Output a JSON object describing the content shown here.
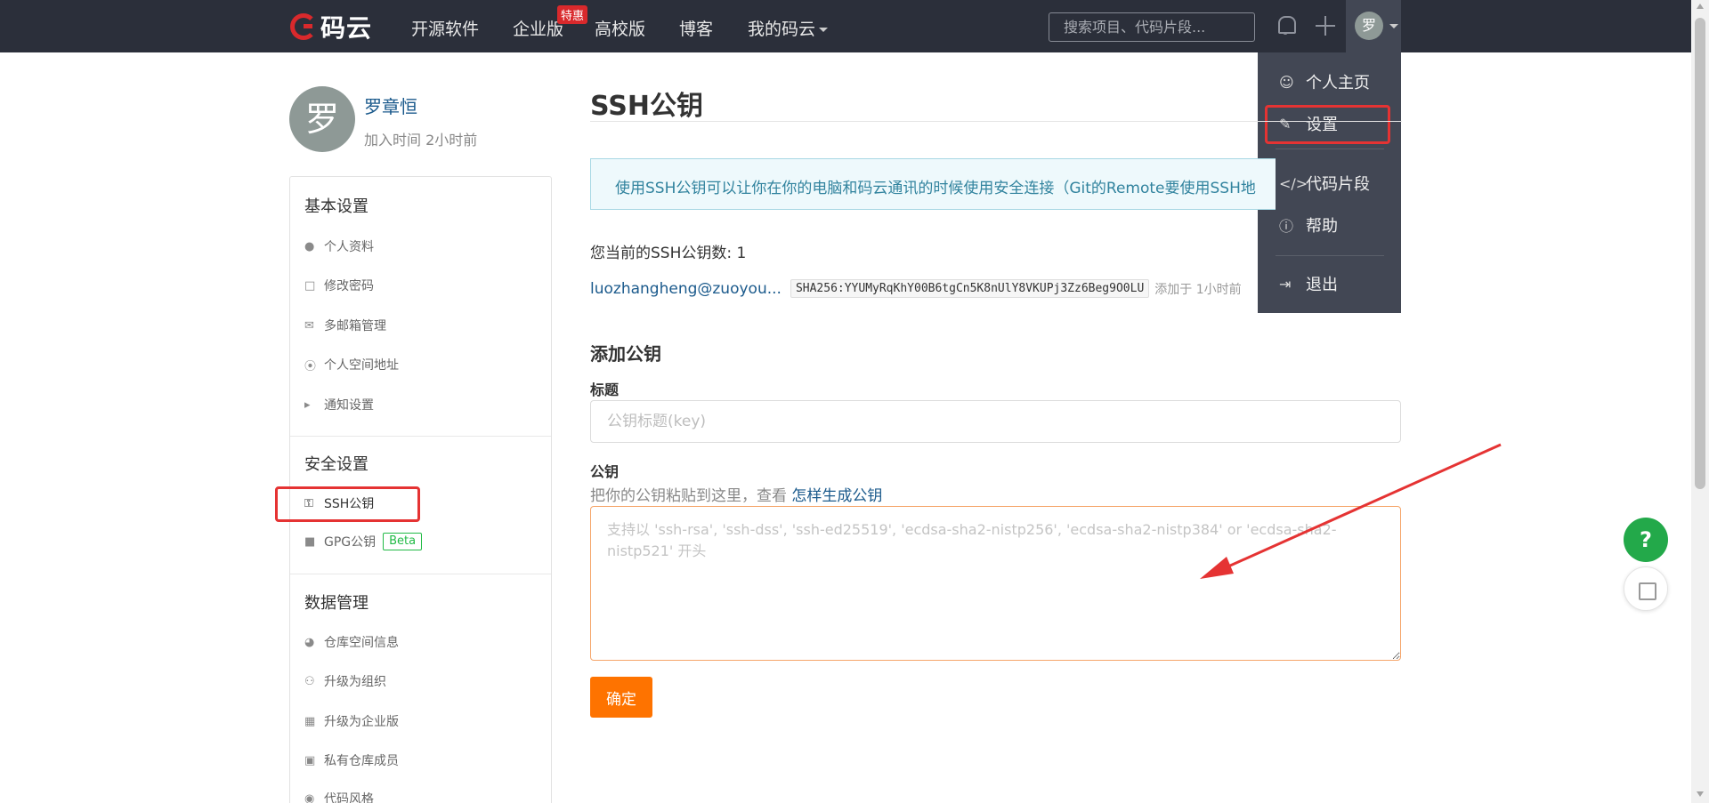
{
  "nav": {
    "brand": "码云",
    "items": [
      "开源软件",
      "企业版",
      "高校版",
      "博客",
      "我的码云"
    ],
    "badge": "特惠",
    "search_placeholder": "搜索项目、代码片段...",
    "avatar_char": "罗"
  },
  "dropdown": {
    "items": [
      {
        "label": "个人主页",
        "icon": "user-icon"
      },
      {
        "label": "设置",
        "icon": "edit-icon"
      },
      {
        "label": "代码片段",
        "icon": "code-icon"
      },
      {
        "label": "帮助",
        "icon": "help-icon"
      },
      {
        "label": "退出",
        "icon": "logout-icon"
      }
    ]
  },
  "profile": {
    "avatar_char": "罗",
    "name": "罗章恒",
    "joined": "加入时间 2小时前"
  },
  "sidebar": {
    "sections": [
      {
        "title": "基本设置",
        "items": [
          "个人资料",
          "修改密码",
          "多邮箱管理",
          "个人空间地址",
          "通知设置"
        ]
      },
      {
        "title": "安全设置",
        "items": [
          "SSH公钥",
          "GPG公钥"
        ]
      },
      {
        "title": "数据管理",
        "items": [
          "仓库空间信息",
          "升级为组织",
          "升级为企业版",
          "私有仓库成员",
          "代码风格"
        ]
      }
    ],
    "beta_label": "Beta"
  },
  "main": {
    "title": "SSH公钥",
    "info": "使用SSH公钥可以让你在你的电脑和码云通讯的时候使用安全连接（Git的Remote要使用SSH地",
    "key_count": "您当前的SSH公钥数: 1",
    "key": {
      "name": "luozhangheng@zuoyou...",
      "fingerprint": "SHA256:YYUMyRqKhY00B6tgCn5K8nUlY8VKUPj3Zz6Beg9O0LU",
      "added": "添加于 1小时前"
    },
    "add_title": "添加公钥",
    "label_title": "标题",
    "title_placeholder": "公钥标题(key)",
    "label_key": "公钥",
    "help_text": "把你的公钥粘贴到这里，查看",
    "help_link": "怎样生成公钥",
    "key_placeholder": "支持以 'ssh-rsa', 'ssh-dss', 'ssh-ed25519', 'ecdsa-sha2-nistp256', 'ecdsa-sha2-nistp384' or 'ecdsa-sha2-nistp521' 开头",
    "submit": "确定"
  },
  "float": {
    "help": "?"
  },
  "colors": {
    "nav_bg": "#2b2f3a",
    "accent_orange": "#fe7300",
    "annotation_red": "#e53333",
    "link_blue": "#1b5a8c"
  }
}
